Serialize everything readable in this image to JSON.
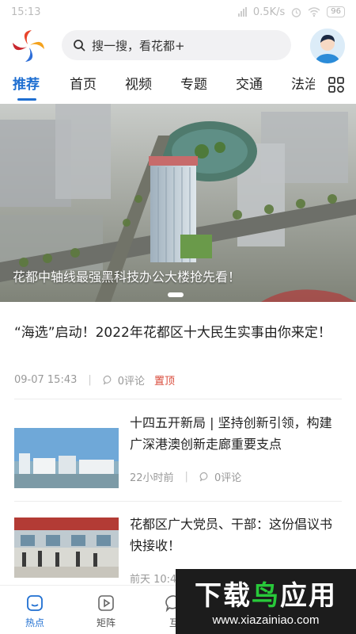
{
  "status_bar": {
    "time": "15:13",
    "speed": "0.5K/s",
    "battery": "96"
  },
  "search": {
    "placeholder": "搜一搜，看花都+"
  },
  "tabs": [
    {
      "label": "推荐",
      "active": true
    },
    {
      "label": "首页"
    },
    {
      "label": "视频"
    },
    {
      "label": "专题"
    },
    {
      "label": "交通"
    },
    {
      "label": "法治"
    }
  ],
  "banner": {
    "caption": "花都中轴线最强黑科技办公大楼抢先看！"
  },
  "top_article": {
    "title": "“海选”启动！2022年花都区十大民生实事由你来定！",
    "date": "09-07 15:43",
    "comments": "0评论",
    "badge": "置顶"
  },
  "news": [
    {
      "title": "十四五开新局 | 坚持创新引领，构建广深港澳创新走廊重要支点",
      "time": "22小时前",
      "comments": "0评论"
    },
    {
      "title": "花都区广大党员、干部：这份倡议书快接收！",
      "time": "前天 10:4"
    }
  ],
  "bottom_nav": [
    {
      "label": "热点",
      "icon": "home-icon",
      "active": true
    },
    {
      "label": "矩阵",
      "icon": "play-icon"
    },
    {
      "label": "互",
      "icon": "chat-icon"
    }
  ],
  "watermark": {
    "title_white": "下载",
    "title_green": "鸟",
    "title_white2": "应用",
    "url": "www.xiazainiao.com"
  },
  "colors": {
    "accent": "#1f6fd1",
    "pinned": "#d94a3a"
  }
}
